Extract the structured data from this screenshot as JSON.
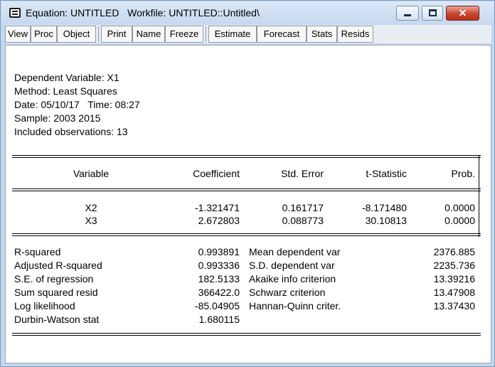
{
  "window": {
    "title": "Equation: UNTITLED   Workfile: UNTITLED::Untitled\\",
    "buttons": {
      "minimize": "minimize",
      "maximize": "maximize",
      "close": "✕"
    }
  },
  "toolbar": {
    "items": [
      "View",
      "Proc",
      "Object",
      "Print",
      "Name",
      "Freeze",
      "Estimate",
      "Forecast",
      "Stats",
      "Resids"
    ]
  },
  "header": {
    "dependent": "Dependent Variable: X1",
    "method": "Method: Least Squares",
    "date": "Date: 05/10/17   Time: 08:27",
    "sample": "Sample: 2003 2015",
    "observations": "Included observations: 13"
  },
  "coef_table": {
    "columns": [
      "Variable",
      "Coefficient",
      "Std. Error",
      "t-Statistic",
      "Prob."
    ],
    "rows": [
      [
        "X2",
        "-1.321471",
        "0.161717",
        "-8.171480",
        "0.0000"
      ],
      [
        "X3",
        "2.672803",
        "0.088773",
        "30.10813",
        "0.0000"
      ]
    ]
  },
  "stats": {
    "left": [
      [
        "R-squared",
        "0.993891"
      ],
      [
        "Adjusted R-squared",
        "0.993336"
      ],
      [
        "S.E. of regression",
        "182.5133"
      ],
      [
        "Sum squared resid",
        "366422.0"
      ],
      [
        "Log likelihood",
        "-85.04905"
      ],
      [
        "Durbin-Watson stat",
        "1.680115"
      ]
    ],
    "right": [
      [
        "Mean dependent var",
        "2376.885"
      ],
      [
        "S.D. dependent var",
        "2235.736"
      ],
      [
        "Akaike info criterion",
        "13.39216"
      ],
      [
        "Schwarz criterion",
        "13.47908"
      ],
      [
        "Hannan-Quinn criter.",
        "13.37430"
      ]
    ]
  }
}
